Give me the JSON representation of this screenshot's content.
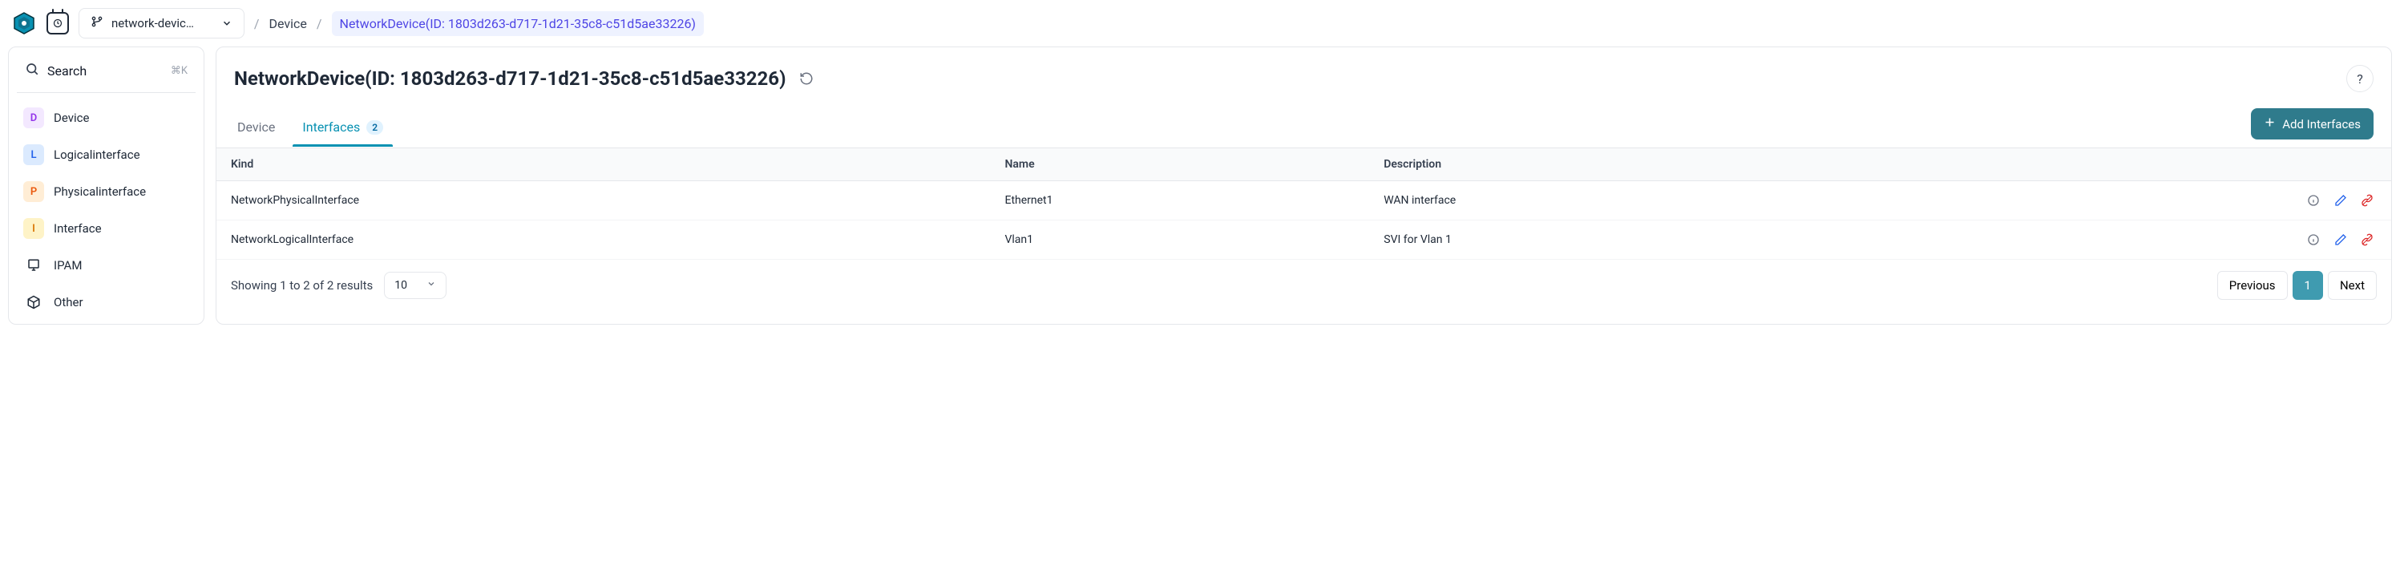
{
  "header": {
    "branch_label": "network-devic…",
    "breadcrumb_root": "Device",
    "breadcrumb_current": "NetworkDevice(ID: 1803d263-d717-1d21-35c8-c51d5ae33226)"
  },
  "sidebar": {
    "search_label": "Search",
    "search_shortcut": "⌘K",
    "items": [
      {
        "badge": "D",
        "label": "Device",
        "badgeClass": "badge-D"
      },
      {
        "badge": "L",
        "label": "Logicalinterface",
        "badgeClass": "badge-L"
      },
      {
        "badge": "P",
        "label": "Physicalinterface",
        "badgeClass": "badge-P"
      },
      {
        "badge": "I",
        "label": "Interface",
        "badgeClass": "badge-I"
      },
      {
        "icon": "ipam",
        "label": "IPAM"
      },
      {
        "icon": "other",
        "label": "Other"
      }
    ]
  },
  "page": {
    "title": "NetworkDevice(ID: 1803d263-d717-1d21-35c8-c51d5ae33226)",
    "help_label": "?"
  },
  "tabs": {
    "device": "Device",
    "interfaces": "Interfaces",
    "interfaces_count": "2",
    "add_button": "Add Interfaces"
  },
  "table": {
    "columns": {
      "kind": "Kind",
      "name": "Name",
      "description": "Description"
    },
    "rows": [
      {
        "kind": "NetworkPhysicalInterface",
        "name": "Ethernet1",
        "description": "WAN interface"
      },
      {
        "kind": "NetworkLogicalInterface",
        "name": "Vlan1",
        "description": "SVI for Vlan 1"
      }
    ]
  },
  "pagination": {
    "results_text": "Showing 1 to 2 of 2 results",
    "page_size": "10",
    "previous": "Previous",
    "current_page": "1",
    "next": "Next"
  }
}
